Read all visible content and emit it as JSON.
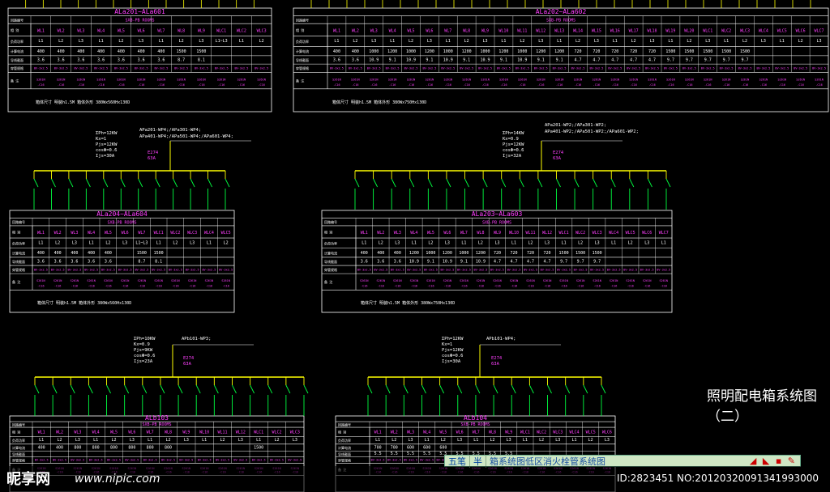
{
  "drawing_title": "照明配电箱系统图（二）",
  "colors": {
    "bg": "#000000",
    "frame": "#ffffff",
    "pink": "#ff40ff",
    "yellow": "#ffff00",
    "green": "#00ff40"
  },
  "row_headers": [
    "回路编号",
    "相 别",
    "负荷功率",
    "计算电流",
    "导线截面",
    "穿管规格",
    "备 注"
  ],
  "panels": [
    {
      "id": "p1",
      "name": "ALa201~ALa601",
      "sub": "SXB-PB ROOMS",
      "circuits": [
        "WL1",
        "WL2",
        "WL3",
        "WL4",
        "WL5",
        "WL6",
        "WL7",
        "WL8",
        "WL9",
        "WLC1",
        "WLC2",
        "WLC3"
      ],
      "phases": [
        "L1",
        "L2",
        "L3",
        "L1",
        "L2",
        "L3",
        "L1",
        "L2",
        "L3",
        "L1~L3",
        "L1",
        "L2"
      ],
      "loads": [
        "400",
        "400",
        "400",
        "400",
        "400",
        "400",
        "400",
        "1500",
        "1500",
        "",
        "",
        ""
      ],
      "currents": [
        "3.6",
        "3.6",
        "3.6",
        "3.6",
        "3.6",
        "3.6",
        "3.6",
        "8.7",
        "8.1",
        "",
        "",
        ""
      ],
      "note": "箱体尺寸 明装h1.5M  箱体外形 380Wx560Hx130D"
    },
    {
      "id": "p2",
      "name": "ALa202~ALa602",
      "sub": "SXB-PB ROOMS",
      "circuits": [
        "WL1",
        "WL2",
        "WL3",
        "WL4",
        "WL5",
        "WL6",
        "WL7",
        "WL8",
        "WL9",
        "WL10",
        "WL11",
        "WL12",
        "WL13",
        "WL14",
        "WL15",
        "WL16",
        "WL17",
        "WL18",
        "WL19",
        "WL20",
        "WLC1",
        "WLC2",
        "WLC3",
        "WLC4",
        "WLC5",
        "WLC6",
        "WLC7"
      ],
      "phases": [
        "L1",
        "L2",
        "L3",
        "L1",
        "L2",
        "L3",
        "L1",
        "L2",
        "L3",
        "L1",
        "L2",
        "L3",
        "L1",
        "L2",
        "L3",
        "L1",
        "L2",
        "L3",
        "L1",
        "L2",
        "L3",
        "L1",
        "L2",
        "L3",
        "L1",
        "L2",
        "L3"
      ],
      "loads": [
        "400",
        "400",
        "1000",
        "1200",
        "1000",
        "1200",
        "1000",
        "1200",
        "1000",
        "1200",
        "1000",
        "1200",
        "1200",
        "720",
        "720",
        "720",
        "720",
        "720",
        "1500",
        "1500",
        "1500",
        "1500",
        "1500",
        "",
        "",
        "",
        ""
      ],
      "currents": [
        "3.6",
        "3.6",
        "10.9",
        "9.1",
        "10.9",
        "9.1",
        "10.9",
        "9.1",
        "10.9",
        "9.1",
        "10.9",
        "9.1",
        "9.1",
        "4.7",
        "4.7",
        "4.7",
        "4.7",
        "4.7",
        "9.7",
        "9.7",
        "9.7",
        "9.7",
        "9.7",
        "",
        "",
        "",
        ""
      ],
      "note": "箱体尺寸 明装h1.5M  箱体外形 380Wx750Hx130D"
    },
    {
      "id": "p3",
      "name": "ALa204~ALa604",
      "sub": "SXB-PB ROOMS",
      "circuits": [
        "WL1",
        "WL2",
        "WL3",
        "WL4",
        "WL5",
        "WL6",
        "WL7",
        "WLC1",
        "WLC2",
        "WLC3",
        "WLC4",
        "WLC5"
      ],
      "phases": [
        "L1",
        "L2",
        "L3",
        "L1",
        "L2",
        "L3",
        "L1~L3",
        "L1",
        "L2",
        "L3",
        "L1",
        "L2"
      ],
      "loads": [
        "400",
        "400",
        "400",
        "400",
        "400",
        "",
        "1500",
        "1500",
        "",
        "",
        "",
        ""
      ],
      "currents": [
        "3.6",
        "3.6",
        "3.6",
        "3.6",
        "3.6",
        "",
        "8.7",
        "8.1",
        "",
        "",
        "",
        ""
      ],
      "note": "箱体尺寸 明装h1.5M  箱体外形 380Wx560Hx130D"
    },
    {
      "id": "p4",
      "name": "ALa203~ALa603",
      "sub": "SXB-PB ROOMS",
      "circuits": [
        "WL1",
        "WL2",
        "WL3",
        "WL4",
        "WL5",
        "WL6",
        "WL7",
        "WL8",
        "WL9",
        "WL10",
        "WL11",
        "WL12",
        "WLC1",
        "WLC2",
        "WLC3",
        "WLC4",
        "WLC5",
        "WLC6",
        "WLC7"
      ],
      "phases": [
        "L1",
        "L2",
        "L3",
        "L1",
        "L2",
        "L3",
        "L1",
        "L2",
        "L3",
        "L1",
        "L2",
        "L3",
        "L1",
        "L2",
        "L3",
        "L1",
        "L2",
        "L3",
        "L1"
      ],
      "loads": [
        "400",
        "400",
        "400",
        "1200",
        "1000",
        "1200",
        "1000",
        "1200",
        "720",
        "720",
        "720",
        "720",
        "1500",
        "1500",
        "1500",
        "",
        "",
        "",
        ""
      ],
      "currents": [
        "3.6",
        "3.6",
        "3.6",
        "10.9",
        "9.1",
        "10.9",
        "9.1",
        "10.9",
        "4.7",
        "4.7",
        "4.7",
        "4.7",
        "9.7",
        "9.7",
        "9.7",
        "",
        "",
        "",
        ""
      ],
      "note": "箱体尺寸 明装h1.5M  箱体外形 380Wx750Hx130D"
    },
    {
      "id": "p5",
      "name": "ALb103",
      "sub": "SXB-PB ROOMS",
      "circuits": [
        "WL1",
        "WL2",
        "WL3",
        "WL4",
        "WL5",
        "WL6",
        "WL7",
        "WL8",
        "WL9",
        "WL10",
        "WL11",
        "WL12",
        "WLC1",
        "WLC2",
        "WLC3"
      ],
      "phases": [
        "L1",
        "L2",
        "L3",
        "L1",
        "L2",
        "L3",
        "L1",
        "L2",
        "L3",
        "L1",
        "L2",
        "L3",
        "L1",
        "L2",
        "L3"
      ],
      "loads": [
        "400",
        "400",
        "800",
        "800",
        "800",
        "800",
        "800",
        "800",
        "",
        "",
        "",
        "",
        "1500",
        "",
        ""
      ],
      "currents": [
        "",
        "",
        "",
        "",
        "",
        "",
        "",
        "",
        "",
        "",
        "",
        "",
        "",
        "",
        ""
      ],
      "note": ""
    },
    {
      "id": "p6",
      "name": "ALb104",
      "sub": "SXB-PB ROOMS",
      "circuits": [
        "WL1",
        "WL2",
        "WL3",
        "WL4",
        "WL5",
        "WL6",
        "WL7",
        "WL8",
        "WL9",
        "WLC1",
        "WLC2",
        "WLC3",
        "WLC4",
        "WLC5",
        "WLC6"
      ],
      "phases": [
        "L1",
        "L2",
        "L3",
        "L1",
        "L2",
        "L3",
        "L1",
        "L2",
        "L3",
        "L1",
        "L2",
        "L3",
        "L1",
        "L2",
        "L3"
      ],
      "loads": [
        "700",
        "700",
        "600",
        "600",
        "600",
        "",
        "",
        "",
        "",
        "",
        "",
        "",
        "",
        "",
        ""
      ],
      "currents": [
        "5.5",
        "5.5",
        "5.5",
        "5.5",
        "5.5",
        "5.5",
        "5.5",
        "5.5",
        "5.5",
        "",
        "",
        "",
        "",
        "",
        ""
      ],
      "note": ""
    }
  ],
  "feeders": [
    {
      "id": "f1",
      "calc": [
        "ΣPh=12KW",
        "Kx=1",
        "Pjs=12KW",
        "cosΦ=0.6",
        "Ijs=30A"
      ],
      "src": [
        "APa201-WP4;/APa301-WP4;",
        "APa401-WP4;/APa501-WP4;/APa601-WP4;"
      ],
      "brk": [
        "E274",
        "63A"
      ]
    },
    {
      "id": "f2",
      "calc": [
        "ΣPh=14KW",
        "Kx=0.9",
        "Pjs=12KW",
        "cosΦ=0.6",
        "Ijs=32A"
      ],
      "src": [
        "APa201-WP2;/APa301-WP2;",
        "APa401-WP2;/APa501-WP2;/APa601-WP2;"
      ],
      "brk": [
        "E274",
        "63A"
      ]
    },
    {
      "id": "f3",
      "calc": [
        "ΣPh=10KW",
        "Kx=0.9",
        "Pjs=9KW",
        "cosΦ=0.6",
        "Ijs=23A"
      ],
      "src": [
        "APb101-WP3;"
      ],
      "brk": [
        "E274",
        "63A"
      ]
    },
    {
      "id": "f4",
      "calc": [
        "ΣPh=12KW",
        "Kx=1",
        "Pjs=12KW",
        "cosΦ=0.6",
        "Ijs=30A"
      ],
      "src": [
        "APb101-WP4;"
      ],
      "brk": [
        "E274",
        "63A"
      ]
    }
  ],
  "ime": {
    "mode_a": "五笔",
    "mode_b": "半",
    "candidates": "箱系统图低区消火栓管系统图",
    "icons": "◢ ◣ ▪ ✎"
  },
  "watermark": {
    "logo": "昵享网",
    "url": "www.nipic.com",
    "id": "ID:2823451 NO:20120320091341993000"
  }
}
